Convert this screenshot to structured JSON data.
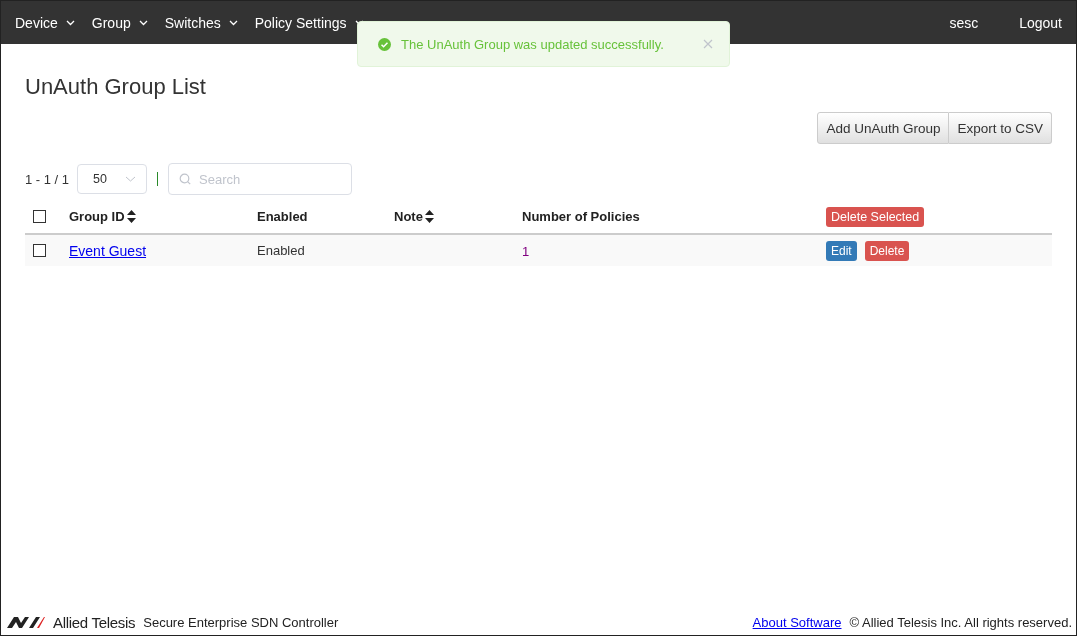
{
  "nav": {
    "items": [
      {
        "label": "Device"
      },
      {
        "label": "Group"
      },
      {
        "label": "Switches"
      },
      {
        "label": "Policy Settings"
      }
    ],
    "user": "sesc",
    "logout": "Logout"
  },
  "toast": {
    "message": "The UnAuth Group was updated successfully."
  },
  "title": "UnAuth Group List",
  "actions": [
    "Add UnAuth Group",
    "Export to CSV"
  ],
  "pager": {
    "range": "1 - 1 / 1",
    "page_size": "50",
    "search_placeholder": "Search"
  },
  "table": {
    "columns": [
      {
        "label": "Group ID",
        "sortable": true
      },
      {
        "label": "Enabled",
        "sortable": false
      },
      {
        "label": "Note",
        "sortable": true
      },
      {
        "label": "Number of Policies",
        "sortable": false
      }
    ],
    "select_all_checked": false,
    "delete_selected": "Delete Selected",
    "rows": [
      {
        "checked": false,
        "group_id": "Event Guest",
        "enabled": "Enabled",
        "note": "",
        "policies": "1",
        "edit": "Edit",
        "delete": "Delete"
      }
    ]
  },
  "footer": {
    "brand": "Allied Telesis",
    "product": "Secure Enterprise SDN Controller",
    "about": "About Software",
    "copyright": "© Allied Telesis Inc. All rights reserved."
  }
}
